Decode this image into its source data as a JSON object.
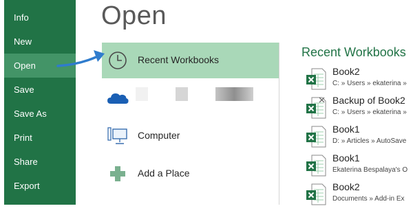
{
  "colors": {
    "sidebar_bg": "#217346",
    "sidebar_active": "#439467",
    "place_active": "#a9d8b8",
    "accent_green": "#217346",
    "arrow_blue": "#2f7ccd",
    "onedrive_blue": "#1a5fb4"
  },
  "sidebar": {
    "items": [
      {
        "label": "Info"
      },
      {
        "label": "New"
      },
      {
        "label": "Open",
        "active": true
      },
      {
        "label": "Save"
      },
      {
        "label": "Save As"
      },
      {
        "label": "Print"
      },
      {
        "label": "Share"
      },
      {
        "label": "Export"
      }
    ]
  },
  "page_title": "Open",
  "places": [
    {
      "label": "Recent Workbooks",
      "icon": "clock-icon",
      "active": true
    },
    {
      "label": "",
      "icon": "onedrive-cloud-icon"
    },
    {
      "label": "Computer",
      "icon": "computer-icon"
    },
    {
      "label": "Add a Place",
      "icon": "plus-icon"
    }
  ],
  "recent": {
    "header": "Recent Workbooks",
    "items": [
      {
        "name": "Book2",
        "path": "C: » Users » ekaterina »"
      },
      {
        "name": "Backup of Book2",
        "path": "C: » Users » ekaterina »"
      },
      {
        "name": "Book1",
        "path": "D: » Articles » AutoSave"
      },
      {
        "name": "Book1",
        "path": "Ekaterina Bespalaya's O"
      },
      {
        "name": "Book2",
        "path": "Documents » Add-in Ex"
      }
    ]
  }
}
